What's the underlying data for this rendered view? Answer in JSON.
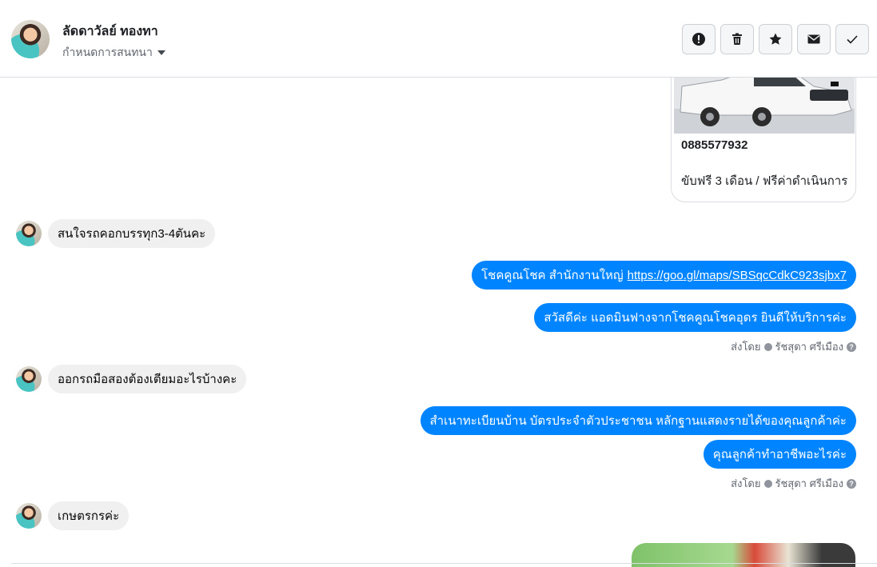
{
  "header": {
    "contact_name": "ลัดดาวัลย์ ทองทา",
    "assign_label": "กำหนดการสนทนา",
    "actions": [
      {
        "name": "spam-button",
        "icon": "alert-icon"
      },
      {
        "name": "delete-button",
        "icon": "trash-icon"
      },
      {
        "name": "star-button",
        "icon": "star-icon"
      },
      {
        "name": "mark-unread-button",
        "icon": "envelope-icon"
      },
      {
        "name": "mark-done-button",
        "icon": "check-icon"
      }
    ]
  },
  "card": {
    "phone": "0885577932",
    "description": "ขับฟรี 3 เดือน / ฟรีค่าดำเนินการ"
  },
  "messages": {
    "in_1": "สนใจรถคอกบรรทุก3-4ตันคะ",
    "out_1_text": "โชคคูณโชค สำนักงานใหญ่",
    "out_1_link": "https://goo.gl/maps/SBSqcCdkC923sjbx7",
    "out_2": "สวัสดีค่ะ แอดมินฟางจากโชคคูณโชคอุดร ยินดีให้บริการค่ะ",
    "sent_by_1_prefix": "ส่งโดย",
    "sent_by_1_name": "รัชสุดา ศรีเมือง",
    "in_2": "ออกรถมือสองต้องเตียมอะไรบ้างคะ",
    "out_3": "สำเนาทะเบียนบ้าน บัตรประจำตัวประชาชน หลักฐานแสดงรายได้ของคุณลูกค้าค่ะ",
    "out_4": "คุณลูกค้าทำอาชีพอะไรค่ะ",
    "sent_by_2_prefix": "ส่งโดย",
    "sent_by_2_name": "รัชสุดา ศรีเมือง",
    "in_3": "เกษตรกรค่ะ"
  },
  "colors": {
    "outgoing_bubble": "#0084ff",
    "incoming_bubble": "#f0f0f0"
  }
}
